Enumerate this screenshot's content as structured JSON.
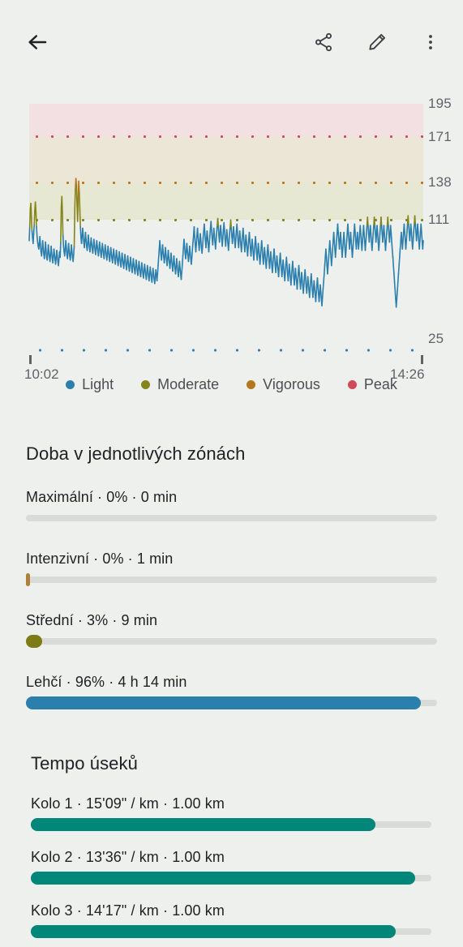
{
  "appbar": {
    "back_label": "Zpět",
    "icons": [
      "back-arrow-icon",
      "share-icon",
      "edit-pencil-icon",
      "more-vert-icon"
    ]
  },
  "chart_data": {
    "type": "line",
    "title": "",
    "xlabel": "",
    "ylabel": "",
    "x_start_label": "10:02",
    "x_end_label": "14:26",
    "y_tick_labels": [
      "195",
      "171",
      "138",
      "111",
      "25"
    ],
    "y_ticks": [
      195,
      171,
      138,
      111,
      25
    ],
    "ylim": [
      25,
      195
    ],
    "grid": false,
    "legend_position": "bottom",
    "legend": [
      {
        "label": "Light",
        "color": "#2b7fae"
      },
      {
        "label": "Moderate",
        "color": "#85841a"
      },
      {
        "label": "Vigorous",
        "color": "#b5761f"
      },
      {
        "label": "Peak",
        "color": "#cf4b58"
      }
    ],
    "zones": [
      {
        "name": "Peak",
        "from": 171,
        "to": 195,
        "band_color": "#f2e0e3",
        "dot_color": "#cf4b58"
      },
      {
        "name": "Vigorous",
        "from": 138,
        "to": 171,
        "band_color": "#ece6d6",
        "dot_color": "#b5761f"
      },
      {
        "name": "Moderate",
        "from": 111,
        "to": 138,
        "band_color": "#e6e8d3",
        "dot_color": "#85841a"
      },
      {
        "name": "Light",
        "from": 25,
        "to": 111,
        "band_color": "transparent",
        "dot_color": "#3f7fae"
      }
    ],
    "series": [
      {
        "name": "Heart rate",
        "values": [
          96,
          106,
          119,
          123,
          112,
          103,
          98,
          94,
          101,
          108,
          118,
          124,
          117,
          106,
          99,
          95,
          92,
          90,
          94,
          99,
          93,
          88,
          85,
          90,
          96,
          91,
          86,
          83,
          88,
          95,
          89,
          84,
          82,
          87,
          93,
          88,
          84,
          81,
          86,
          92,
          87,
          83,
          80,
          85,
          90,
          86,
          82,
          79,
          84,
          89,
          85,
          81,
          78,
          83,
          88,
          84,
          95,
          120,
          128,
          116,
          100,
          92,
          88,
          85,
          90,
          96,
          91,
          86,
          83,
          88,
          94,
          89,
          85,
          82,
          87,
          93,
          88,
          84,
          81,
          86,
          92,
          119,
          133,
          141,
          136,
          122,
          110,
          127,
          139,
          131,
          118,
          106,
          98,
          94,
          99,
          105,
          100,
          95,
          91,
          96,
          102,
          97,
          92,
          89,
          94,
          100,
          95,
          91,
          88,
          93,
          98,
          94,
          90,
          87,
          92,
          97,
          93,
          89,
          86,
          91,
          96,
          92,
          88,
          85,
          90,
          95,
          91,
          87,
          84,
          89,
          94,
          90,
          86,
          83,
          88,
          93,
          89,
          85,
          82,
          87,
          92,
          88,
          84,
          81,
          86,
          91,
          87,
          83,
          80,
          85,
          90,
          86,
          82,
          79,
          84,
          89,
          85,
          81,
          78,
          83,
          88,
          84,
          80,
          77,
          82,
          87,
          83,
          79,
          76,
          81,
          86,
          82,
          78,
          75,
          80,
          85,
          81,
          77,
          74,
          79,
          84,
          80,
          76,
          73,
          78,
          83,
          79,
          75,
          72,
          77,
          82,
          78,
          74,
          71,
          76,
          81,
          77,
          73,
          70,
          75,
          80,
          76,
          72,
          69,
          74,
          79,
          75,
          71,
          68,
          73,
          78,
          74,
          70,
          67,
          72,
          77,
          73,
          69,
          66,
          71,
          76,
          72,
          68,
          65,
          70,
          75,
          71,
          67,
          72,
          78,
          84,
          90,
          96,
          91,
          86,
          82,
          87,
          93,
          88,
          84,
          80,
          85,
          91,
          86,
          82,
          78,
          83,
          89,
          84,
          80,
          76,
          81,
          87,
          82,
          78,
          74,
          79,
          85,
          80,
          76,
          72,
          77,
          83,
          78,
          74,
          70,
          75,
          81,
          76,
          72,
          68,
          73,
          79,
          85,
          91,
          97,
          92,
          87,
          83,
          88,
          94,
          89,
          85,
          81,
          86,
          92,
          87,
          83,
          79,
          84,
          90,
          95,
          100,
          106,
          99,
          93,
          88,
          94,
          100,
          105,
          99,
          94,
          89,
          95,
          101,
          96,
          91,
          87,
          92,
          98,
          103,
          108,
          102,
          96,
          91,
          97,
          103,
          98,
          93,
          88,
          94,
          100,
          105,
          110,
          104,
          98,
          93,
          99,
          105,
          100,
          95,
          90,
          96,
          102,
          107,
          112,
          106,
          100,
          95,
          101,
          107,
          102,
          97,
          92,
          98,
          104,
          109,
          103,
          97,
          92,
          98,
          104,
          99,
          94,
          89,
          95,
          101,
          106,
          111,
          105,
          99,
          94,
          100,
          106,
          101,
          96,
          91,
          97,
          103,
          108,
          102,
          96,
          91,
          97,
          103,
          98,
          93,
          88,
          94,
          100,
          105,
          99,
          93,
          88,
          94,
          100,
          95,
          90,
          85,
          91,
          97,
          102,
          96,
          90,
          85,
          91,
          97,
          92,
          87,
          82,
          88,
          94,
          99,
          93,
          87,
          82,
          88,
          94,
          89,
          84,
          79,
          85,
          91,
          96,
          90,
          84,
          79,
          85,
          91,
          86,
          81,
          76,
          82,
          88,
          93,
          87,
          81,
          76,
          82,
          88,
          83,
          78,
          73,
          79,
          85,
          90,
          84,
          78,
          73,
          79,
          85,
          80,
          75,
          70,
          76,
          82,
          87,
          81,
          75,
          70,
          76,
          82,
          77,
          72,
          67,
          73,
          79,
          84,
          78,
          72,
          67,
          73,
          79,
          74,
          69,
          64,
          70,
          76,
          81,
          75,
          69,
          64,
          70,
          76,
          71,
          66,
          61,
          67,
          73,
          78,
          72,
          66,
          61,
          67,
          73,
          68,
          63,
          58,
          64,
          70,
          75,
          69,
          63,
          58,
          64,
          70,
          65,
          60,
          55,
          61,
          67,
          72,
          66,
          60,
          55,
          61,
          67,
          62,
          57,
          52,
          58,
          64,
          69,
          63,
          57,
          52,
          58,
          64,
          59,
          54,
          49,
          55,
          61,
          66,
          72,
          78,
          84,
          90,
          84,
          78,
          72,
          78,
          84,
          90,
          96,
          90,
          84,
          78,
          84,
          90,
          96,
          102,
          96,
          90,
          84,
          90,
          96,
          102,
          108,
          102,
          96,
          90,
          96,
          102,
          96,
          90,
          84,
          90,
          96,
          102,
          96,
          90,
          84,
          90,
          96,
          102,
          108,
          102,
          96,
          90,
          96,
          102,
          96,
          90,
          84,
          90,
          96,
          102,
          108,
          102,
          96,
          90,
          96,
          102,
          96,
          90,
          95,
          101,
          107,
          101,
          95,
          89,
          95,
          101,
          107,
          101,
          95,
          89,
          95,
          101,
          107,
          113,
          107,
          101,
          95,
          101,
          107,
          101,
          95,
          89,
          95,
          101,
          107,
          113,
          107,
          101,
          95,
          101,
          107,
          101,
          95,
          89,
          95,
          101,
          107,
          113,
          107,
          101,
          95,
          101,
          107,
          101,
          95,
          89,
          95,
          101,
          107,
          113,
          107,
          101,
          95,
          101,
          107,
          101,
          95,
          89,
          84,
          78,
          72,
          66,
          60,
          54,
          48,
          54,
          60,
          66,
          72,
          78,
          84,
          90,
          96,
          102,
          96,
          90,
          96,
          102,
          108,
          102,
          96,
          90,
          96,
          102,
          108,
          114,
          108,
          102,
          96,
          102,
          108,
          102,
          96,
          90,
          96,
          102,
          108,
          114,
          108,
          102,
          96,
          102,
          108,
          102,
          96,
          90,
          96,
          102,
          108,
          102,
          96,
          90,
          96
        ]
      }
    ]
  },
  "zones_section": {
    "title": "Doba v jednotlivých zónách",
    "rows": [
      {
        "label": "Maximální · 0% · 0 min",
        "percent": 0,
        "color": "#cf4b58",
        "name": "maximum"
      },
      {
        "label": "Intenzivní · 0% · 1 min",
        "percent": 1,
        "color": "#b08038",
        "name": "vigorous"
      },
      {
        "label": "Střední · 3% · 9 min",
        "percent": 4,
        "color": "#7e7b17",
        "name": "moderate"
      },
      {
        "label": "Lehčí · 96% · 4 h 14 min",
        "percent": 96,
        "color": "#2a7fad",
        "name": "light"
      }
    ]
  },
  "laps_section": {
    "title": "Tempo úseků",
    "bar_color": "#00877a",
    "rows": [
      {
        "label": "Kolo 1 · 15'09\" / km · 1.00 km",
        "percent": 86
      },
      {
        "label": "Kolo 2 · 13'36\" / km · 1.00 km",
        "percent": 96
      },
      {
        "label": "Kolo 3 · 14'17\" / km · 1.00 km",
        "percent": 91
      }
    ]
  },
  "theme": {
    "background": "#eef0ee",
    "track": "#d9dbd9",
    "text": "#202124",
    "muted_text": "#5f6368"
  }
}
